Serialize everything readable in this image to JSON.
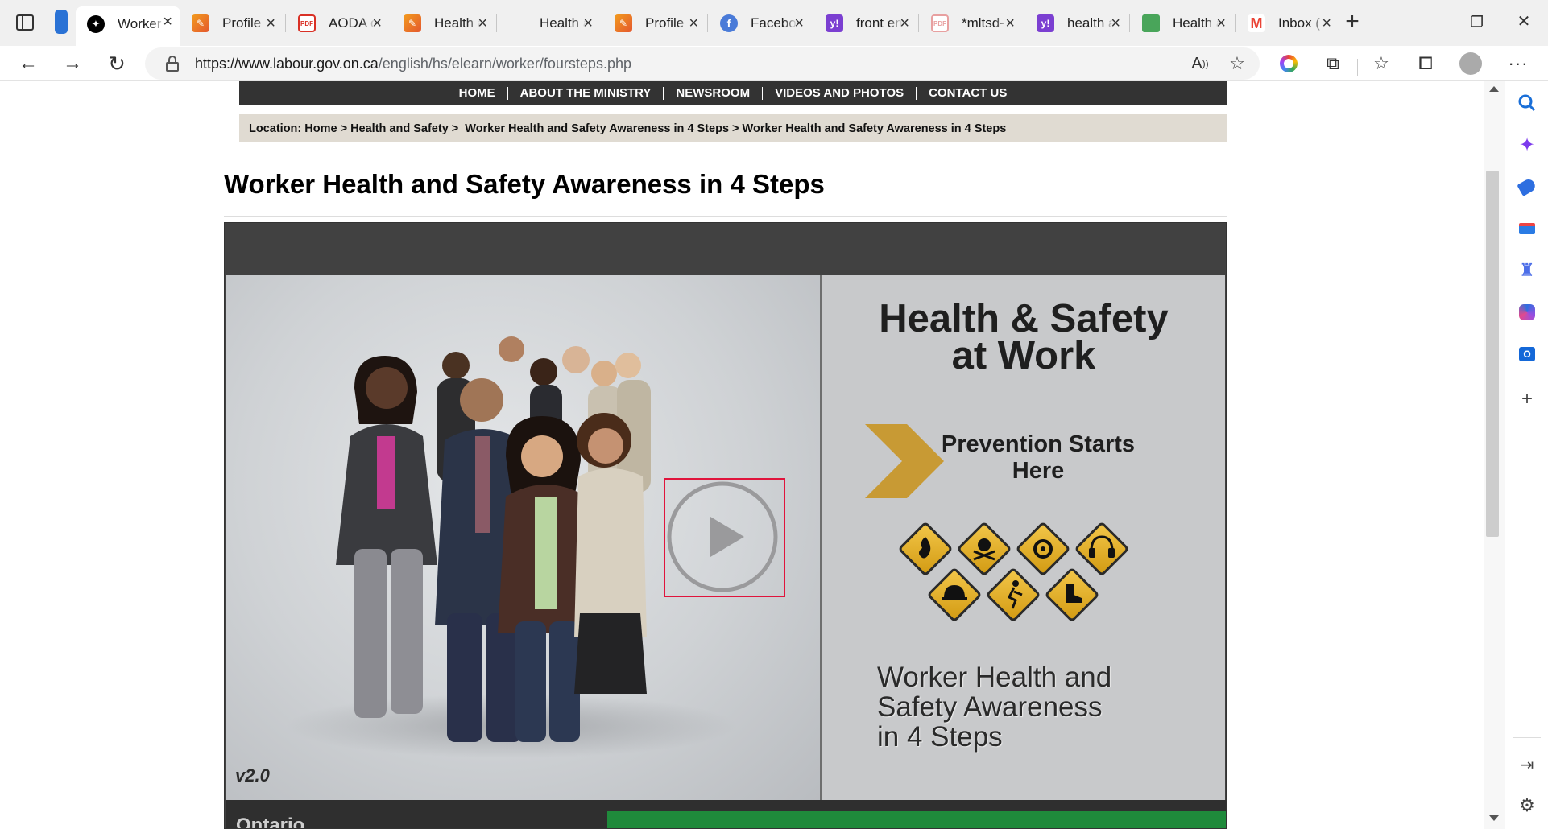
{
  "browser": {
    "tabs": [
      {
        "title": "Worker Health and Safety",
        "active": true,
        "favicon": "ontario-trillium-icon",
        "color": "#000000"
      },
      {
        "title": "Profile",
        "active": false,
        "favicon": "pencil-app-icon",
        "color": "#f29b1d"
      },
      {
        "title": "AODA customer service",
        "active": false,
        "favicon": "pdf-icon",
        "color": "#d93025"
      },
      {
        "title": "Health and Safety",
        "active": false,
        "favicon": "pencil-app-icon",
        "color": "#f29b1d"
      },
      {
        "title": "Health and Safety",
        "active": false,
        "favicon": "blank-page-icon",
        "color": "#ffffff"
      },
      {
        "title": "Profile",
        "active": false,
        "favicon": "pencil-app-icon",
        "color": "#f29b1d"
      },
      {
        "title": "Facebook",
        "active": false,
        "favicon": "facebook-icon",
        "color": "#4a7bd8"
      },
      {
        "title": "front end",
        "active": false,
        "favicon": "yahoo-icon",
        "color": "#7b3fd1"
      },
      {
        "title": "*mltsd-",
        "active": false,
        "favicon": "pdf-icon",
        "color": "#e8a0a0"
      },
      {
        "title": "health and",
        "active": false,
        "favicon": "yahoo-icon",
        "color": "#7b3fd1"
      },
      {
        "title": "Health and",
        "active": false,
        "favicon": "green-document-icon",
        "color": "#49a55a"
      },
      {
        "title": "Inbox (",
        "active": false,
        "favicon": "gmail-icon",
        "color": "#ea4335"
      }
    ],
    "url_host": "https://www.labour.gov.on.ca",
    "url_path": "/english/hs/elearn/worker/foursteps.php",
    "new_tab_label": "+",
    "window_controls": {
      "minimize": "—",
      "maximize": "❐",
      "close": "✕"
    }
  },
  "site": {
    "nav": [
      "HOME",
      "ABOUT THE MINISTRY",
      "NEWSROOM",
      "VIDEOS AND PHOTOS",
      "CONTACT US"
    ],
    "breadcrumb": "Location: Home > Health and Safety >  Worker Health and Safety Awareness in 4 Steps > Worker Health and Safety Awareness in 4 Steps",
    "page_title": "Worker Health and Safety Awareness in 4 Steps"
  },
  "video": {
    "poster_title_line1": "Health & Safety",
    "poster_title_line2": "at Work",
    "tagline_line1": "Prevention Starts",
    "tagline_line2": "Here",
    "subtitle_line1": "Worker Health and",
    "subtitle_line2": "Safety Awareness",
    "subtitle_line3": "in 4 Steps",
    "version": "v2.0",
    "footer_logo_text": "Ontario",
    "hazard_icons": [
      "flame-icon",
      "skull-crossbones-icon",
      "biohazard-icon",
      "ear-protection-icon",
      "hard-hat-icon",
      "fall-hazard-icon",
      "safety-boot-icon"
    ],
    "accent_gold": "#c89a34",
    "highlight_color": "#e0143c"
  }
}
